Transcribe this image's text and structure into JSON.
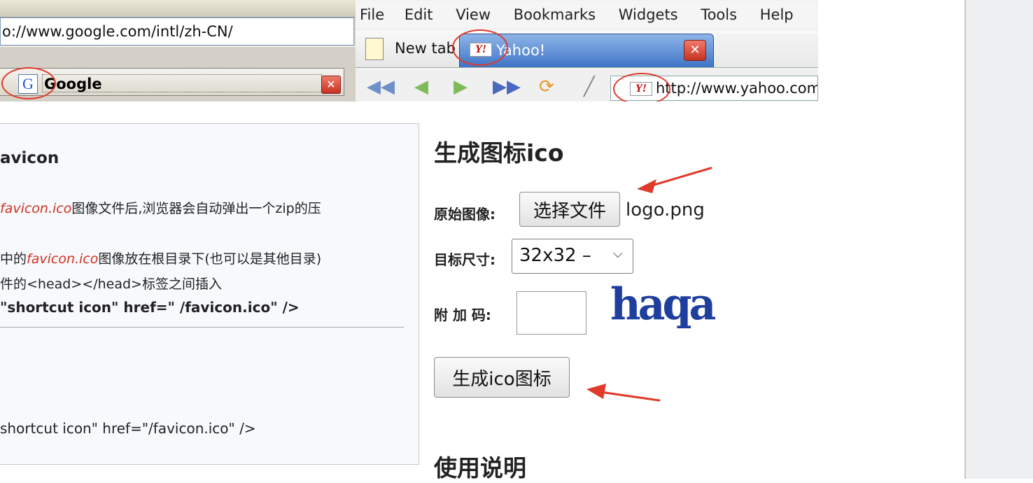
{
  "screenshot_a": {
    "url": "o://www.google.com/intl/zh-CN/",
    "tab_icon": "G",
    "tab_title": "Google",
    "close_glyph": "✕"
  },
  "screenshot_b": {
    "menu": [
      "File",
      "Edit",
      "View",
      "Bookmarks",
      "Widgets",
      "Tools",
      "Help"
    ],
    "new_tab_label": "New tab",
    "yahoo_icon": "Y!",
    "yahoo_tab_label": "Yahoo!",
    "close_glyph": "✕",
    "address": "http://www.yahoo.com"
  },
  "left_panel": {
    "title": "avicon",
    "line1_em": "favicon.ico",
    "line1_rest": "图像文件后,浏览器会自动弹出一个zip的压",
    "line2_pre": "中的",
    "line2_em": "favicon.ico",
    "line2_rest": "图像放在根目录下(也可以是其他目录)",
    "line3": "件的<head></head>标签之间插入",
    "code1": "\"shortcut icon\" href=\" /favicon.ico\" />",
    "code2": "shortcut icon\" href=\"/favicon.ico\" />"
  },
  "form": {
    "heading": "生成图标ico",
    "original_label": "原始图像:",
    "choose_file_label": "选择文件",
    "file_name": "logo.png",
    "size_label": "目标尺寸:",
    "size_value": "32x32 –",
    "code_label": "附 加 码:",
    "captcha_text": "haqa",
    "submit_label": "生成ico图标",
    "usage_heading": "使用说明"
  },
  "colors": {
    "annotation_red": "#e03a2a",
    "captcha_blue": "#1e3f9e",
    "emphasis_red": "#d03020"
  }
}
